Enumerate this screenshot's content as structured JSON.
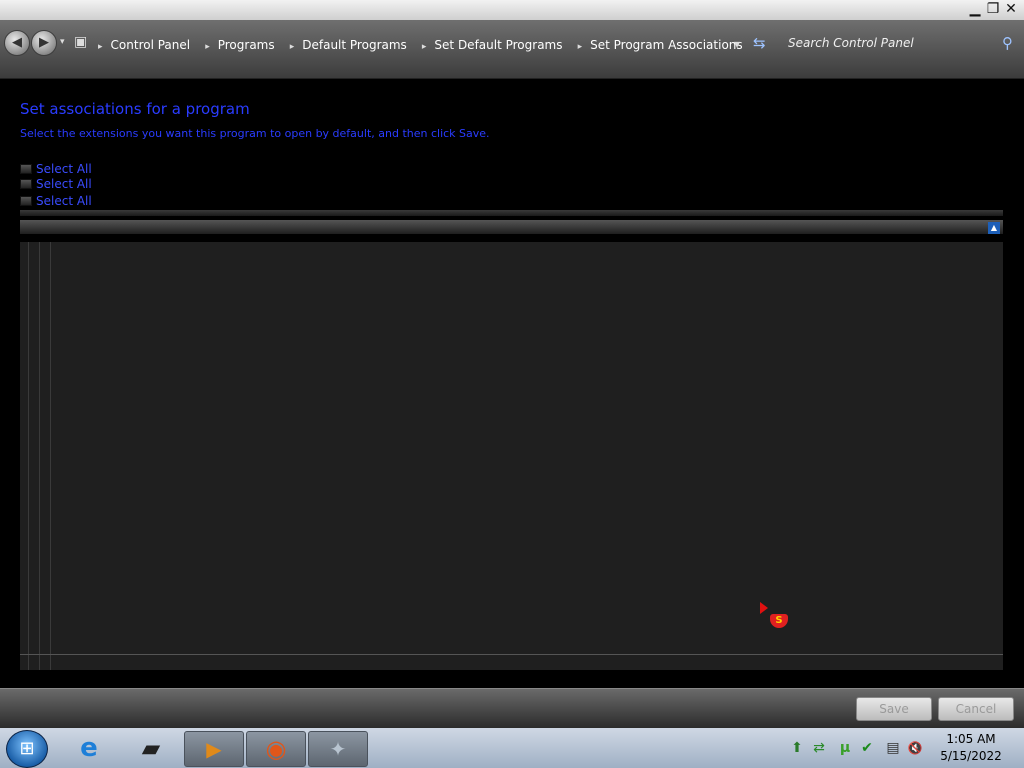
{
  "window": {
    "minimize_glyph": "▁",
    "restore_glyph": "❐",
    "close_glyph": "✕"
  },
  "nav": {
    "back_glyph": "◀",
    "forward_glyph": "▶",
    "history_glyph": "▾",
    "root_icon_glyph": "▣",
    "breadcrumbs": [
      "Control Panel",
      "Programs",
      "Default Programs",
      "Set Default Programs",
      "Set Program Associations"
    ],
    "crumb_separator": "▸",
    "dropdown_glyph": "▾",
    "refresh_glyph": "⇆",
    "search_placeholder": "Search Control Panel",
    "search_glyph": "⚲"
  },
  "main": {
    "title": "Set associations for a program",
    "description": "Select the extensions you want this program to open by default, and then click Save.",
    "select_all": [
      "Select All",
      "Select All",
      "Select All"
    ],
    "scroll_up_glyph": "▲"
  },
  "footer": {
    "save_label": "Save",
    "cancel_label": "Cancel"
  },
  "taskbar": {
    "start_glyph": "⊞",
    "items": [
      {
        "name": "internet-explorer",
        "glyph": "e",
        "color": "#1e7fd8"
      },
      {
        "name": "app-monitor",
        "glyph": "▰",
        "color": "#222"
      },
      {
        "name": "media-player",
        "glyph": "▶",
        "color": "#e08a1a"
      },
      {
        "name": "firefox",
        "glyph": "◉",
        "color": "#e0561a"
      },
      {
        "name": "control-panel",
        "glyph": "✦",
        "color": "#7a8896"
      }
    ],
    "tray": [
      "⬆",
      "⇄",
      "µ",
      "✔",
      "▤",
      "🔇"
    ],
    "clock_time": "1:05 AM",
    "clock_date": "5/15/2022"
  },
  "colors": {
    "title_blue": "#2a3cff",
    "link_blue": "#3a4cff"
  }
}
